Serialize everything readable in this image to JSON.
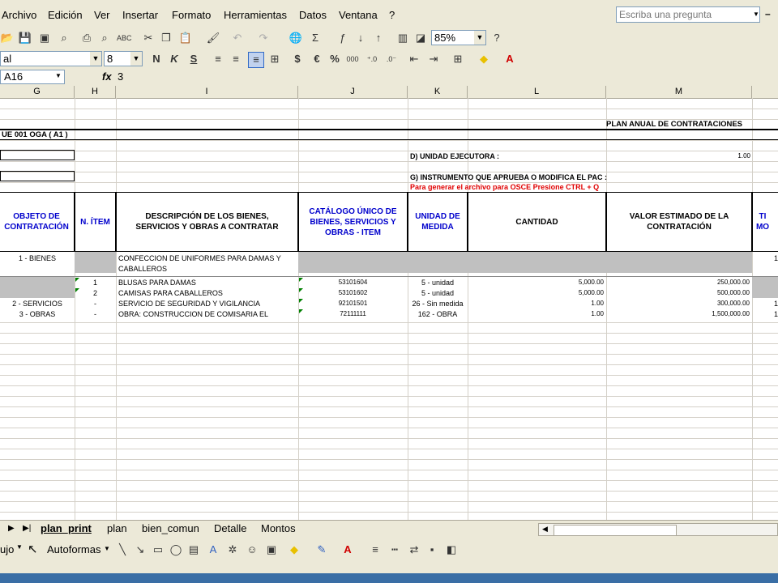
{
  "menu": {
    "items": [
      "Archivo",
      "Edición",
      "Ver",
      "Insertar",
      "Formato",
      "Herramientas",
      "Datos",
      "Ventana",
      "?"
    ],
    "help_placeholder": "Escriba una pregunta"
  },
  "toolbar": {
    "zoom": "85%",
    "font_name": "al",
    "font_size": "8"
  },
  "formula_bar": {
    "cell_ref": "A16",
    "fx_label": "fx",
    "value": "3"
  },
  "columns": [
    "G",
    "H",
    "I",
    "J",
    "K",
    "L",
    "M"
  ],
  "sheet": {
    "title": "PLAN ANUAL DE CONTRATACIONES",
    "ue_label": "UE 001 OGA ( A1 )",
    "unidad_ejecutora_label": "D) UNIDAD EJECUTORA :",
    "unidad_ejecutora_value": "1.00",
    "instrumento_label": "G) INSTRUMENTO QUE APRUEBA O MODIFICA EL PAC :",
    "osce_note": "Para generar el archivo para OSCE Presione CTRL + Q",
    "headers": {
      "objeto": "OBJETO DE CONTRATACIÓN",
      "item": "N. ÍTEM",
      "descripcion": "DESCRIPCIÓN DE LOS BIENES, SERVICIOS Y OBRAS A CONTRATAR",
      "catalogo": "CATÁLOGO ÚNICO DE BIENES, SERVICIOS Y OBRAS - ITEM",
      "unidad": "UNIDAD DE MEDIDA",
      "cantidad": "CANTIDAD",
      "valor": "VALOR ESTIMADO DE LA CONTRATACIÓN",
      "extra": "TI MO"
    },
    "rows": [
      {
        "objeto": "1 - BIENES",
        "item": "",
        "descripcion": "CONFECCION DE UNIFORMES PARA DAMAS Y",
        "catalogo": "",
        "unidad": "",
        "cantidad": "",
        "valor": "",
        "extra": "1"
      },
      {
        "objeto": "",
        "item": "",
        "descripcion": "CABALLEROS",
        "catalogo": "",
        "unidad": "",
        "cantidad": "",
        "valor": "",
        "extra": ""
      },
      {
        "objeto": "",
        "item": "1",
        "descripcion": "BLUSAS PARA DAMAS",
        "catalogo": "53101604",
        "unidad": "5 - unidad",
        "cantidad": "5,000.00",
        "valor": "250,000.00",
        "extra": ""
      },
      {
        "objeto": "",
        "item": "2",
        "descripcion": "CAMISAS PARA CABALLEROS",
        "catalogo": "53101602",
        "unidad": "5 - unidad",
        "cantidad": "5,000.00",
        "valor": "500,000.00",
        "extra": ""
      },
      {
        "objeto": "2 - SERVICIOS",
        "item": "-",
        "descripcion": "SERVICIO DE SEGURIDAD Y VIGILANCIA",
        "catalogo": "92101501",
        "unidad": "26 - Sin medida",
        "cantidad": "1.00",
        "valor": "300,000.00",
        "extra": "1"
      },
      {
        "objeto": "3 - OBRAS",
        "item": "-",
        "descripcion": "OBRA: CONSTRUCCION DE COMISARIA EL",
        "catalogo": "72111111",
        "unidad": "162 - OBRA",
        "cantidad": "1.00",
        "valor": "1,500,000.00",
        "extra": "1"
      }
    ]
  },
  "tabs": [
    "plan_print",
    "plan",
    "bien_comun",
    "Detalle",
    "Montos"
  ],
  "drawing": {
    "dibujo": "ujo",
    "autoformas": "Autoformas"
  }
}
